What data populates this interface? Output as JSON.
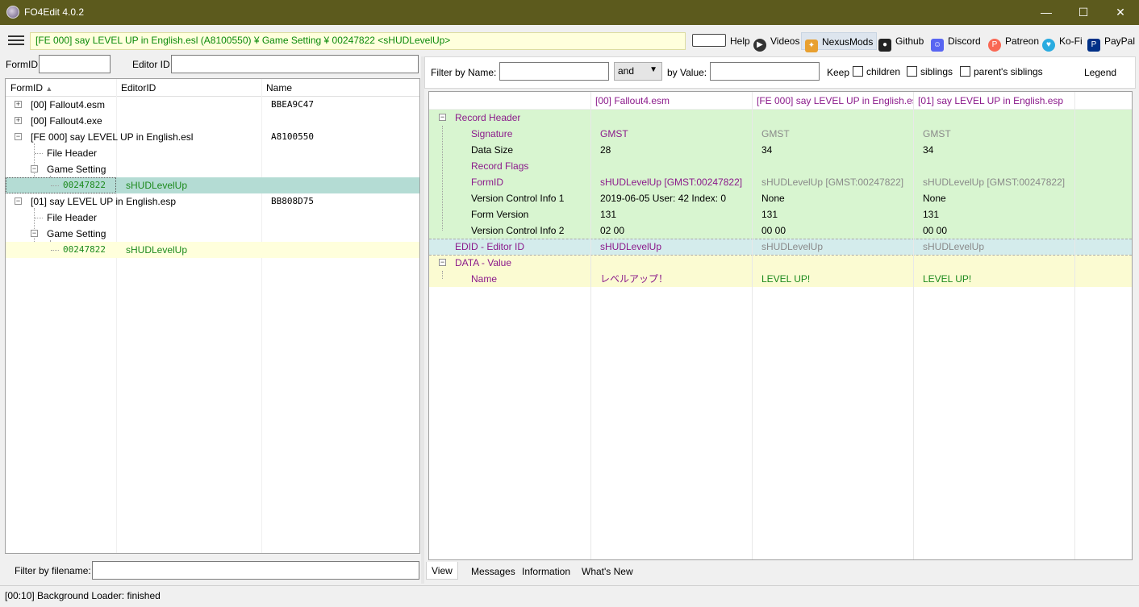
{
  "window": {
    "title": "FO4Edit 4.0.2",
    "minimize": "—",
    "maximize": "☐",
    "close": "✕"
  },
  "toolbar": {
    "path": "[FE 000] say LEVEL UP in English.esl (A8100550) ¥ Game Setting ¥ 00247822 <sHUDLevelUp>",
    "help": "Help",
    "videos": "Videos",
    "nexusmods": "NexusMods",
    "github": "Github",
    "discord": "Discord",
    "patreon": "Patreon",
    "kofi": "Ko-Fi",
    "paypal": "PayPal"
  },
  "left": {
    "formid_label": "FormID",
    "formid_value": "",
    "editorid_label": "Editor ID",
    "editorid_value": "",
    "columns": [
      "FormID",
      "EditorID",
      "Name"
    ],
    "rows": [
      {
        "label": "[00] Fallout4.esm",
        "name": "BBEA9C47"
      },
      {
        "label": "[00] Fallout4.exe",
        "name": ""
      },
      {
        "label": "[FE 000] say LEVEL UP in English.esl",
        "name": "A8100550"
      },
      {
        "label": "File Header",
        "name": ""
      },
      {
        "label": "Game Setting",
        "name": ""
      },
      {
        "label": "00247822",
        "editorid": "sHUDLevelUp"
      },
      {
        "label": "[01] say LEVEL UP in English.esp",
        "name": "BB808D75"
      },
      {
        "label": "File Header",
        "name": ""
      },
      {
        "label": "Game Setting",
        "name": ""
      },
      {
        "label": "00247822",
        "editorid": "sHUDLevelUp"
      }
    ],
    "filter_filename_label": "Filter by filename:",
    "filter_filename_value": ""
  },
  "right": {
    "filter_name_label": "Filter by Name:",
    "filter_name_value": "",
    "op_value": "and",
    "filter_value_label": "by Value:",
    "filter_value_value": "",
    "keep_label": "Keep",
    "children_label": "children",
    "siblings_label": "siblings",
    "parents_siblings_label": "parent's siblings",
    "legend_label": "Legend",
    "columns": [
      "[00] Fallout4.esm",
      "[FE 000] say LEVEL UP in English.esl",
      "[01] say LEVEL UP in English.esp"
    ],
    "rows": [
      {
        "label": "Record Header",
        "v1": "",
        "v2": "",
        "v3": ""
      },
      {
        "label": "Signature",
        "v1": "GMST",
        "v2": "GMST",
        "v3": "GMST"
      },
      {
        "label": "Data Size",
        "v1": "28",
        "v2": "34",
        "v3": "34"
      },
      {
        "label": "Record Flags",
        "v1": "",
        "v2": "",
        "v3": ""
      },
      {
        "label": "FormID",
        "v1": "sHUDLevelUp [GMST:00247822]",
        "v2": "sHUDLevelUp [GMST:00247822]",
        "v3": "sHUDLevelUp [GMST:00247822]"
      },
      {
        "label": "Version Control Info 1",
        "v1": "2019-06-05 User: 42 Index: 0",
        "v2": "None",
        "v3": "None"
      },
      {
        "label": "Form Version",
        "v1": "131",
        "v2": "131",
        "v3": "131"
      },
      {
        "label": "Version Control Info 2",
        "v1": "02 00",
        "v2": "00 00",
        "v3": "00 00"
      },
      {
        "label": "EDID - Editor ID",
        "v1": "sHUDLevelUp",
        "v2": "sHUDLevelUp",
        "v3": "sHUDLevelUp"
      },
      {
        "label": "DATA - Value",
        "v1": "",
        "v2": "",
        "v3": ""
      },
      {
        "label": "Name",
        "v1": "レベルアップ！",
        "v2": "LEVEL UP!",
        "v3": "LEVEL UP!"
      }
    ],
    "tabs": [
      "View",
      "Messages",
      "Information",
      "What's New"
    ]
  },
  "status": "[00:10] Background Loader: finished"
}
